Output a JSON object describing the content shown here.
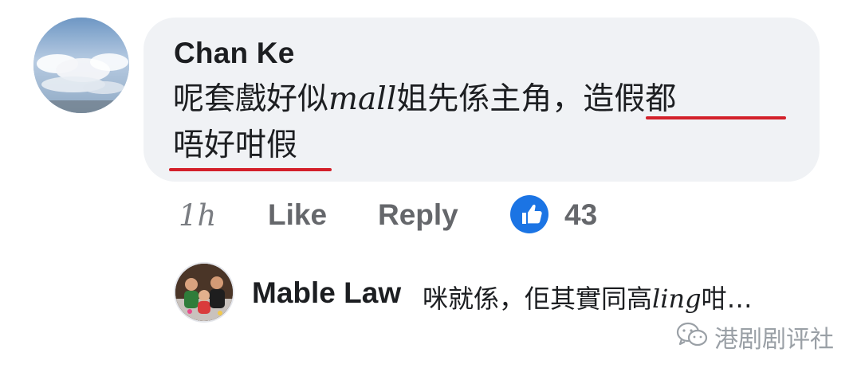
{
  "comment": {
    "author": "Chan Ke",
    "text_line1_part1": "呢套戲好似",
    "text_line1_latin": "mall",
    "text_line1_part2": "姐先係主角，",
    "text_line1_underlined": "造假都",
    "text_line2_underlined": "唔好咁假",
    "time": "1h",
    "like_label": "Like",
    "reply_label": "Reply",
    "reaction_count": "43",
    "reaction_icon": "thumbs-up-icon"
  },
  "reply": {
    "author": "Mable Law",
    "text_part1": "咪就係，佢其實同高",
    "text_latin": "ling",
    "text_part2": "咁…"
  },
  "watermark": {
    "label": "港剧剧评社",
    "icon": "wechat-icon"
  },
  "colors": {
    "bubble": "#f0f2f5",
    "underline": "#d3202a",
    "like_blue": "#1b74e4",
    "secondary_text": "#65676b"
  }
}
